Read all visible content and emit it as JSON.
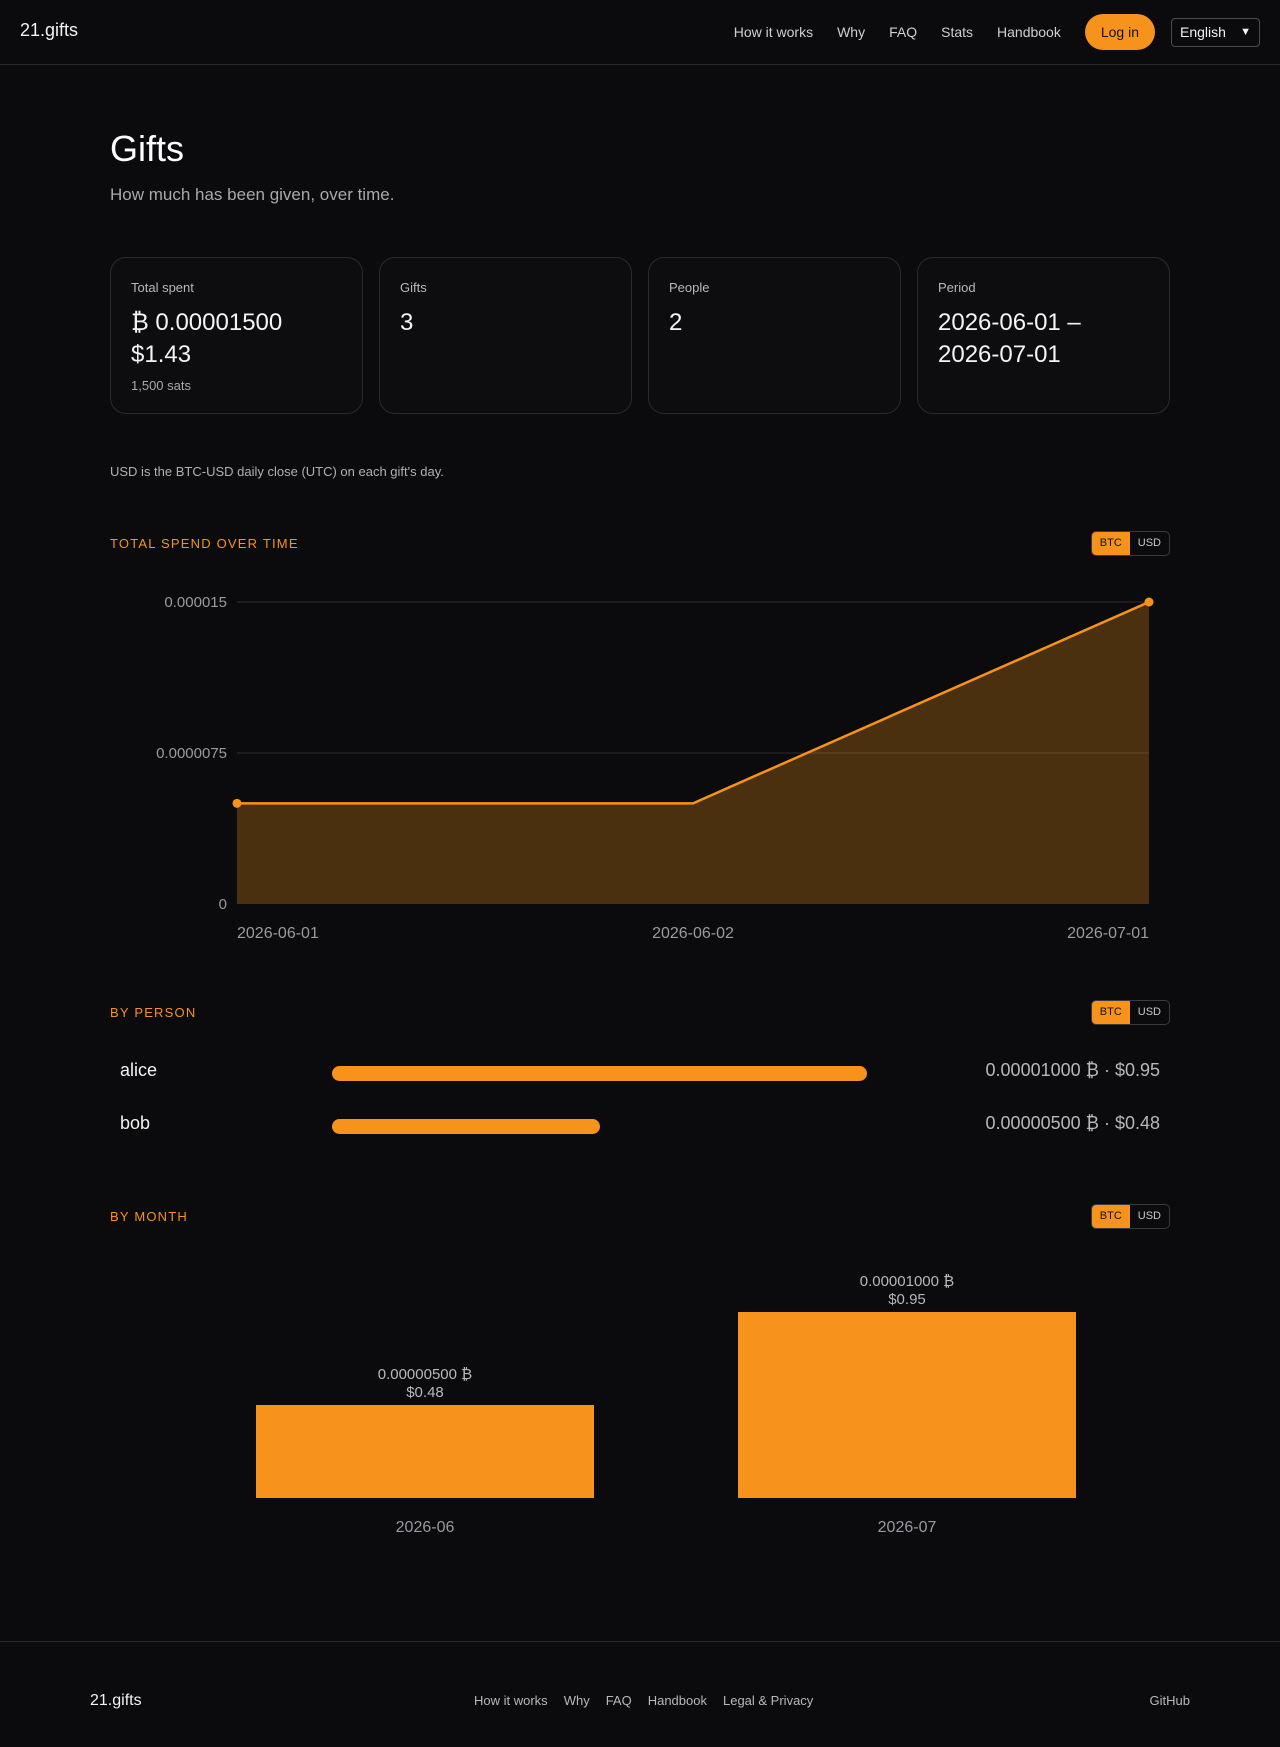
{
  "header": {
    "brand": "21.gifts",
    "nav": [
      "How it works",
      "Why",
      "FAQ",
      "Stats",
      "Handbook"
    ],
    "login_label": "Log in",
    "language": "English"
  },
  "page": {
    "title": "Gifts",
    "subtitle": "How much has been given, over time."
  },
  "cards": [
    {
      "label": "Total spent",
      "value": "₿ 0.00001500",
      "value2": "$1.43",
      "small": "1,500 sats"
    },
    {
      "label": "Gifts",
      "value": "3"
    },
    {
      "label": "People",
      "value": "2"
    },
    {
      "label": "Period",
      "value": "2026-06-01 –",
      "value2": "2026-07-01"
    }
  ],
  "note": "USD is the BTC-USD daily close (UTC) on each gift's day.",
  "toggle": {
    "btc": "BTC",
    "usd": "USD"
  },
  "sections": {
    "spend": "Total spend over time",
    "person": "By person",
    "month": "By month"
  },
  "people": [
    {
      "name": "alice",
      "value": "0.00001000 ₿ · $0.95",
      "fraction": 1.0
    },
    {
      "name": "bob",
      "value": "0.00000500 ₿ · $0.48",
      "fraction": 0.5
    }
  ],
  "chart_data": [
    {
      "type": "area",
      "title": "Total spend over time",
      "x": [
        "2026-06-01",
        "2026-06-02",
        "2026-07-01"
      ],
      "series": [
        {
          "values": [
            5e-06,
            5e-06,
            1.5e-05
          ]
        }
      ],
      "yticks": [
        "0",
        "0.0000075",
        "0.000015"
      ],
      "ylim": [
        0,
        1.5e-05
      ],
      "grid": true,
      "color": "#f7931a"
    },
    {
      "type": "bar",
      "title": "By month",
      "categories": [
        "2026-06",
        "2026-07"
      ],
      "values": [
        5e-06,
        1e-05
      ],
      "labels_btc": [
        "0.00000500 ₿",
        "0.00001000 ₿"
      ],
      "labels_usd": [
        "$0.48",
        "$0.95"
      ],
      "color": "#f7931a"
    }
  ],
  "footer": {
    "brand": "21.gifts",
    "links": [
      "How it works",
      "Why",
      "FAQ",
      "Handbook",
      "Legal & Privacy"
    ],
    "github": "GitHub"
  }
}
